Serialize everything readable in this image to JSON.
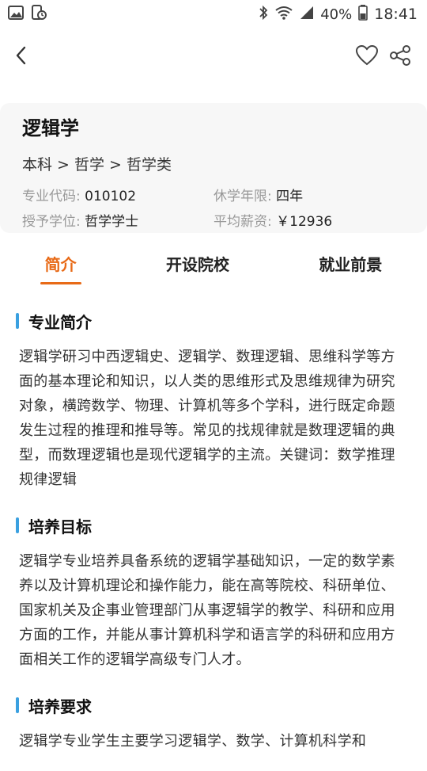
{
  "status": {
    "battery": "40%",
    "time": "18:41"
  },
  "major": {
    "name": "逻辑学",
    "path": "本科 > 哲学 > 哲学类",
    "code_label": "专业代码:",
    "code_value": "010102",
    "years_label": "休学年限:",
    "years_value": "四年",
    "degree_label": "授予学位:",
    "degree_value": "哲学学士",
    "salary_label": "平均薪资:",
    "salary_value": "￥12936"
  },
  "tabs": [
    {
      "label": "简介"
    },
    {
      "label": "开设院校"
    },
    {
      "label": "就业前景"
    }
  ],
  "sections": [
    {
      "title": "专业简介",
      "body": "逻辑学研习中西逻辑史、逻辑学、数理逻辑、思维科学等方面的基本理论和知识，以人类的思维形式及思维规律为研究对象，横跨数学、物理、计算机等多个学科，进行既定命题发生过程的推理和推导等。常见的找规律就是数理逻辑的典型，而数理逻辑也是现代逻辑学的主流。关键词：数学推理规律逻辑"
    },
    {
      "title": "培养目标",
      "body": "逻辑学专业培养具备系统的逻辑学基础知识，一定的数学素养以及计算机理论和操作能力，能在高等院校、科研单位、国家机关及企事业管理部门从事逻辑学的教学、科研和应用方面的工作，并能从事计算机科学和语言学的科研和应用方面相关工作的逻辑学高级专门人才。"
    },
    {
      "title": "培养要求",
      "body": "逻辑学专业学生主要学习逻辑学、数学、计算机科学和"
    }
  ],
  "colors": {
    "accent": "#e86a17",
    "section_bar": "#3aa0e0",
    "card_bg": "#f7f7f7"
  },
  "icons": {
    "status_left": [
      "image-icon",
      "phone-clock-icon"
    ],
    "status_right": [
      "bluetooth-icon",
      "wifi-icon",
      "signal-icon",
      "battery-icon"
    ],
    "topbar": [
      "back-icon",
      "heart-icon",
      "share-icon"
    ]
  }
}
